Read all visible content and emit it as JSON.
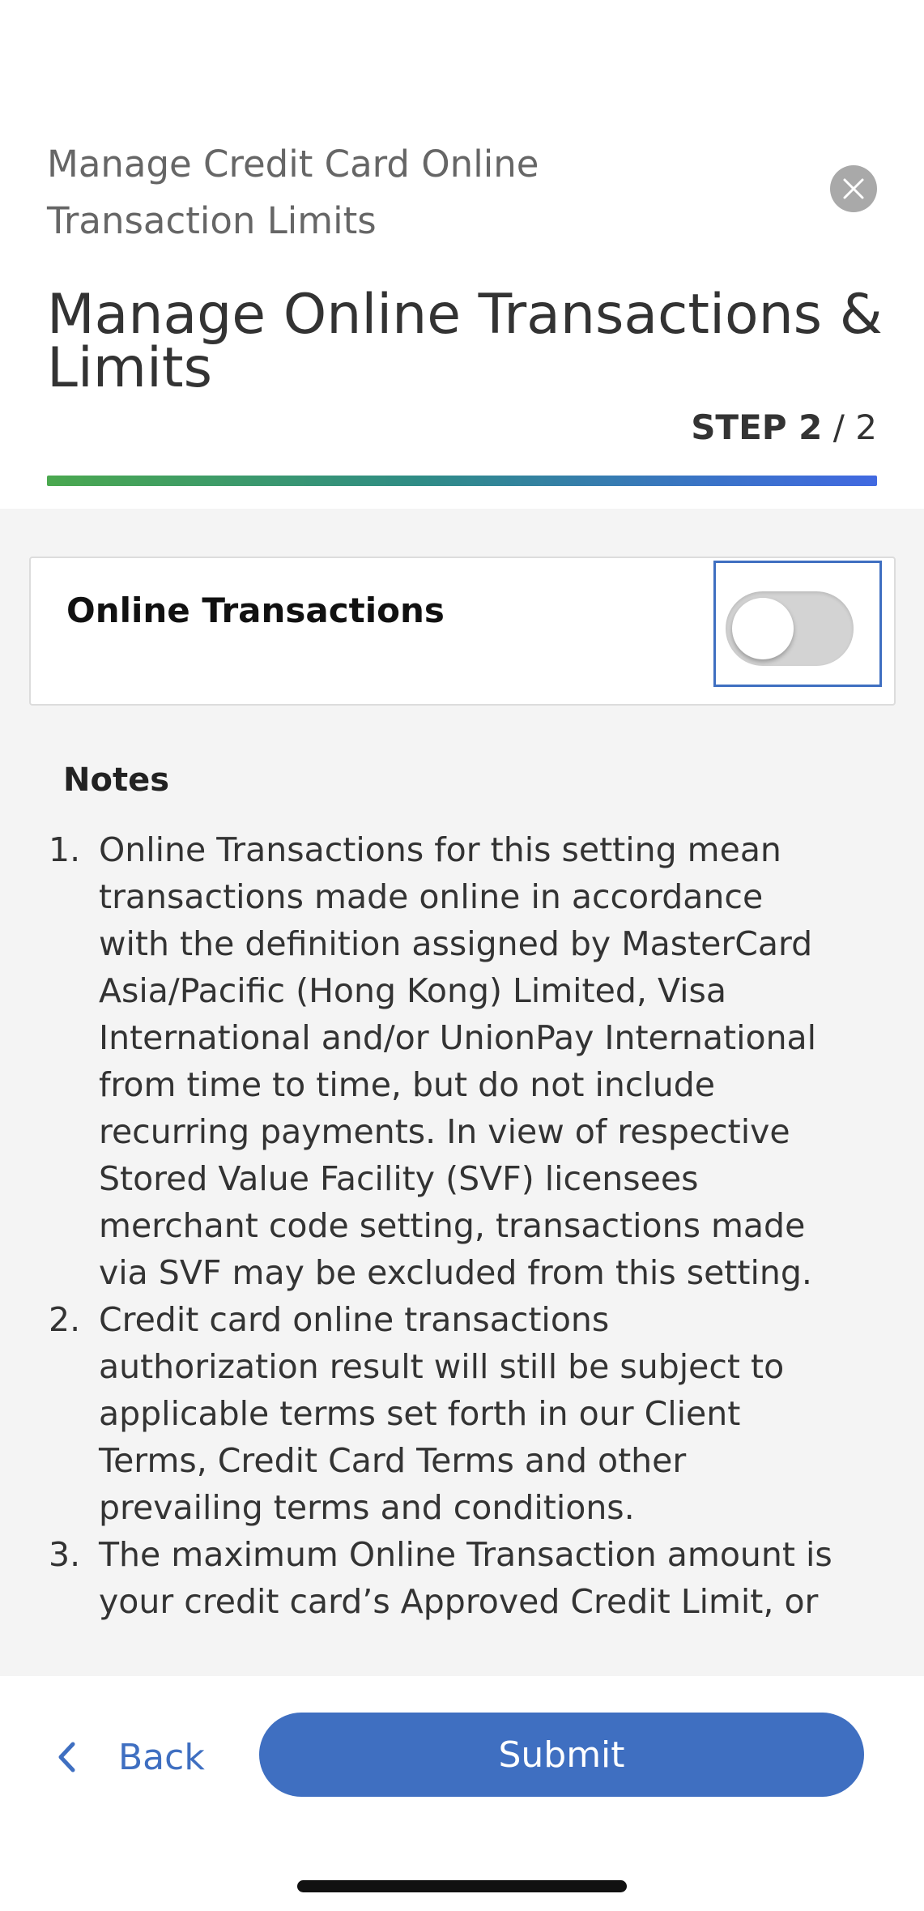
{
  "header": {
    "supertitle": "Manage Credit Card Online Transaction Limits",
    "title": "Manage Online Transactions & Limits",
    "step": {
      "label": "STEP 2",
      "total": "/ 2"
    },
    "progress_fraction": 1.0
  },
  "toggle": {
    "label": "Online Transactions",
    "on": false
  },
  "notes": {
    "heading": "Notes",
    "items": [
      {
        "num": "1.",
        "text": "Online Transactions for this setting mean transactions made online in accordance with the definition assigned by MasterCard Asia/Pacific (Hong Kong) Limited, Visa International and/or UnionPay International from time to time, but do not include recurring payments. In view of respective Stored Value Facility (SVF) licensees merchant code setting, transactions made via SVF may be excluded from this setting."
      },
      {
        "num": "2.",
        "text": "Credit card online transactions authorization result will still be subject to applicable terms set forth in our Client Terms, Credit Card Terms and other prevailing terms and conditions."
      },
      {
        "num": "3.",
        "text": "The maximum Online Transaction amount is your credit card’s Approved Credit Limit, or"
      }
    ]
  },
  "footer": {
    "back_label": "Back",
    "submit_label": "Submit"
  },
  "colors": {
    "accent": "#3f6fc1",
    "progress_start": "#4aa84f",
    "progress_end": "#4169e1",
    "content_bg": "#f4f4f4"
  },
  "icons": {
    "close": "close-icon",
    "back": "chevron-left-icon"
  }
}
